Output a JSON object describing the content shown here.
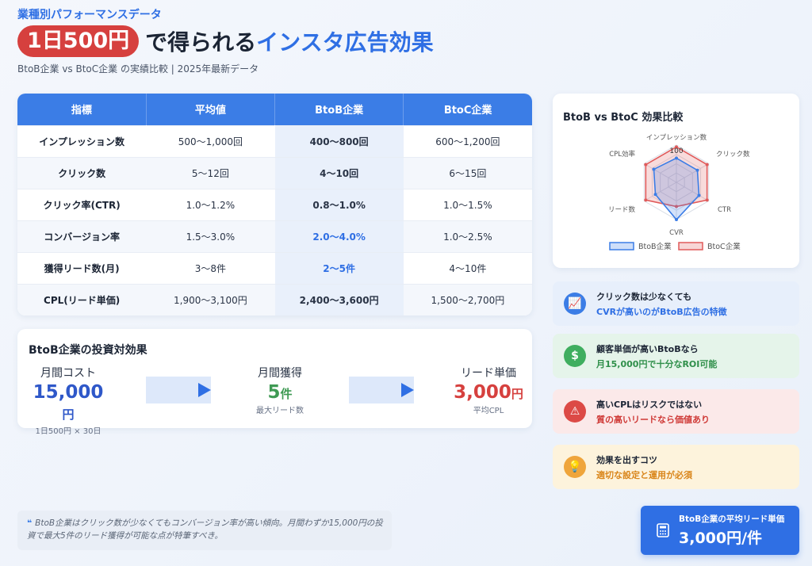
{
  "header": {
    "eyebrow": "業種別パフォーマンスデータ",
    "pill": "1日500円",
    "title_mid": "で得られる",
    "title_blue": "インスタ広告効果",
    "subtitle": "BtoB企業 vs BtoC企業 の実績比較 | 2025年最新データ"
  },
  "table": {
    "headers": [
      "指標",
      "平均値",
      "BtoB企業",
      "BtoC企業"
    ],
    "rows": [
      {
        "label": "インプレッション数",
        "avg": "500〜1,000回",
        "btob": "400〜800回",
        "btoc": "600〜1,200回"
      },
      {
        "label": "クリック数",
        "avg": "5〜12回",
        "btob": "4〜10回",
        "btoc": "6〜15回"
      },
      {
        "label": "クリック率(CTR)",
        "avg": "1.0〜1.2%",
        "btob": "0.8〜1.0%",
        "btoc": "1.0〜1.5%"
      },
      {
        "label": "コンバージョン率",
        "avg": "1.5〜3.0%",
        "btob": "2.0〜4.0%",
        "btoc": "1.0〜2.5%"
      },
      {
        "label": "獲得リード数(月)",
        "avg": "3〜8件",
        "btob": "2〜5件",
        "btoc": "4〜10件"
      },
      {
        "label": "CPL(リード単価)",
        "avg": "1,900〜3,100円",
        "btob": "2,400〜3,600円",
        "btoc": "1,500〜2,700円"
      }
    ]
  },
  "roi": {
    "title": "BtoB企業の投資対効果",
    "cost": {
      "label": "月間コスト",
      "value": "15,000",
      "unit": "円",
      "note": "1日500円 × 30日",
      "color": "#2f58c9"
    },
    "leads": {
      "label": "月間獲得",
      "value": "5",
      "unit": "件",
      "note": "最大リード数",
      "color": "#3f9a54"
    },
    "cpl": {
      "label": "リード単価",
      "value": "3,000",
      "unit": "円",
      "note": "平均CPL",
      "color": "#d6403e"
    }
  },
  "quote": {
    "mark": "❝",
    "text": "BtoB企業はクリック数が少なくてもコンバージョン率が高い傾向。月間わずか15,000円の投資で最大5件のリード獲得が可能な点が特筆すべき。"
  },
  "chart_data": {
    "type": "radar",
    "title": "BtoB vs BtoC 効果比較",
    "axes": [
      "インプレッション数",
      "クリック数",
      "CTR",
      "CVR",
      "リード数",
      "CPL効率"
    ],
    "tick_label": "100",
    "rmax": 100,
    "series": [
      {
        "name": "BtoB企業",
        "values": [
          65,
          65,
          70,
          100,
          65,
          70
        ],
        "color": "#3b7de6"
      },
      {
        "name": "BtoC企業",
        "values": [
          95,
          95,
          95,
          65,
          95,
          95
        ],
        "color": "#e05a5a"
      }
    ],
    "legend_position": "bottom"
  },
  "tips": [
    {
      "icon": "chart-icon",
      "symbol": "📈",
      "line1": "クリック数は少なくても",
      "line2": "CVRが高いのがBtoB広告の特徴",
      "accent": "#2f6fe4",
      "bg": "#e7effb",
      "icon_bg": "#3b7de6"
    },
    {
      "icon": "dollar-icon",
      "symbol": "$",
      "line1": "顧客単価が高いBtoBなら",
      "line2": "月15,000円で十分なROI可能",
      "accent": "#2f8f4a",
      "bg": "#e5f4ea",
      "icon_bg": "#3fae5f"
    },
    {
      "icon": "warning-icon",
      "symbol": "⚠",
      "line1": "高いCPLはリスクではない",
      "line2": "質の高いリードなら価値あり",
      "accent": "#cf3a37",
      "bg": "#fbe9e9",
      "icon_bg": "#dc4a46"
    },
    {
      "icon": "lightbulb-icon",
      "symbol": "💡",
      "line1": "効果を出すコツ",
      "line2": "適切な設定と運用が必須",
      "accent": "#d9851a",
      "bg": "#fdf3dc",
      "icon_bg": "#efa53b"
    }
  ],
  "cta": {
    "line1": "BtoB企業の平均リード単価",
    "line2": "3,000円/件"
  }
}
